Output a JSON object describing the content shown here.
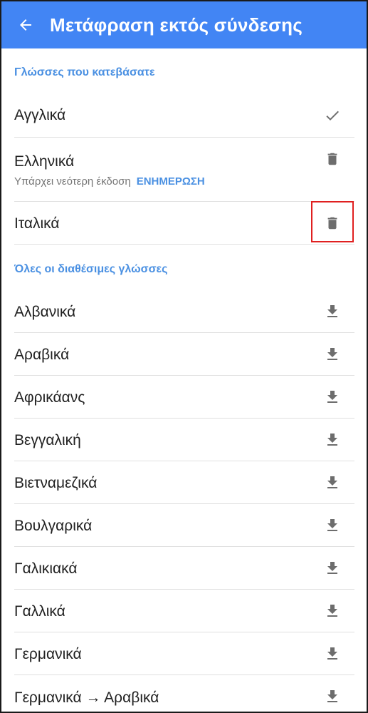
{
  "appbar": {
    "title": "Μετάφραση εκτός σύνδεσης",
    "back_icon": "arrow-back-icon",
    "background": "#4285f4"
  },
  "downloaded_section": {
    "header": "Γλώσσες που κατεβάσατε",
    "items": [
      {
        "label": "Αγγλικά",
        "icon": "check-icon"
      },
      {
        "label": "Ελληνικά",
        "icon": "delete-icon",
        "subtitle": "Υπάρχει νεότερη έκδοση",
        "action": "ΕΝΗΜΕΡΩΣΗ"
      },
      {
        "label": "Ιταλικά",
        "icon": "delete-icon",
        "highlighted": true
      }
    ]
  },
  "available_section": {
    "header": "Όλες οι διαθέσιμες γλώσσες",
    "items": [
      {
        "label": "Αλβανικά",
        "icon": "download-icon"
      },
      {
        "label": "Αραβικά",
        "icon": "download-icon"
      },
      {
        "label": "Αφρικάανς",
        "icon": "download-icon"
      },
      {
        "label": "Βεγγαλική",
        "icon": "download-icon"
      },
      {
        "label": "Βιετναμεζικά",
        "icon": "download-icon"
      },
      {
        "label": "Βουλγαρικά",
        "icon": "download-icon"
      },
      {
        "label": "Γαλικιακά",
        "icon": "download-icon"
      },
      {
        "label": "Γαλλικά",
        "icon": "download-icon"
      },
      {
        "label": "Γερμανικά",
        "icon": "download-icon"
      },
      {
        "label": "Γερμανικά → Αραβικά",
        "icon": "download-icon"
      }
    ]
  },
  "colors": {
    "accent": "#4a90e2",
    "icon": "#6d6d6d",
    "highlight": "#e02020"
  }
}
